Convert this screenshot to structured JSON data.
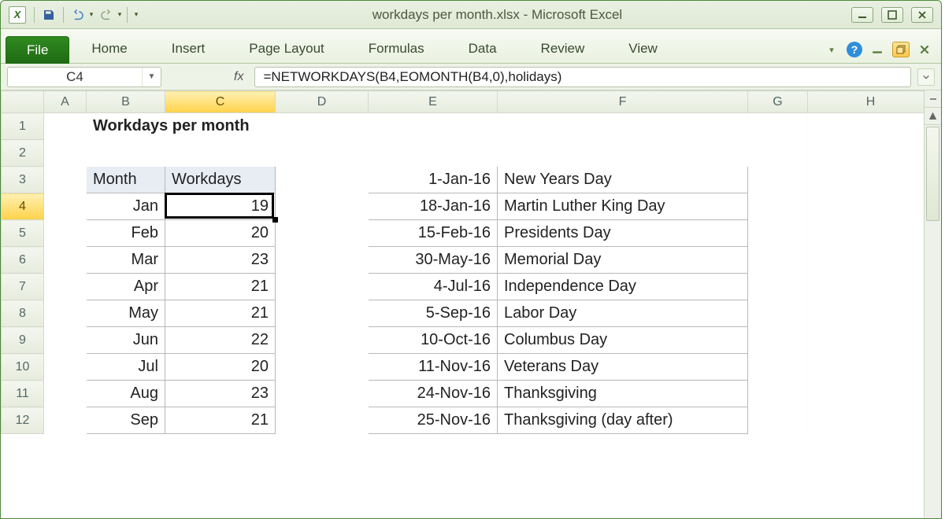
{
  "title": "workdays per month.xlsx  -  Microsoft Excel",
  "ribbon": {
    "file": "File",
    "tabs": [
      "Home",
      "Insert",
      "Page Layout",
      "Formulas",
      "Data",
      "Review",
      "View"
    ]
  },
  "namebox": "C4",
  "fx": "fx",
  "formula": "=NETWORKDAYS(B4,EOMONTH(B4,0),holidays)",
  "columns": [
    "A",
    "B",
    "C",
    "D",
    "E",
    "F",
    "G",
    "H"
  ],
  "rows": [
    "1",
    "2",
    "3",
    "4",
    "5",
    "6",
    "7",
    "8",
    "9",
    "10",
    "11",
    "12"
  ],
  "sheet_title": "Workdays per month",
  "table1": {
    "headers": {
      "b": "Month",
      "c": "Workdays"
    },
    "rows": [
      {
        "b": "Jan",
        "c": "19"
      },
      {
        "b": "Feb",
        "c": "20"
      },
      {
        "b": "Mar",
        "c": "23"
      },
      {
        "b": "Apr",
        "c": "21"
      },
      {
        "b": "May",
        "c": "21"
      },
      {
        "b": "Jun",
        "c": "22"
      },
      {
        "b": "Jul",
        "c": "20"
      },
      {
        "b": "Aug",
        "c": "23"
      },
      {
        "b": "Sep",
        "c": "21"
      }
    ]
  },
  "table2": {
    "rows": [
      {
        "e": "1-Jan-16",
        "f": "New Years Day"
      },
      {
        "e": "18-Jan-16",
        "f": "Martin Luther King Day"
      },
      {
        "e": "15-Feb-16",
        "f": "Presidents Day"
      },
      {
        "e": "30-May-16",
        "f": "Memorial Day"
      },
      {
        "e": "4-Jul-16",
        "f": "Independence Day"
      },
      {
        "e": "5-Sep-16",
        "f": "Labor Day"
      },
      {
        "e": "10-Oct-16",
        "f": "Columbus Day"
      },
      {
        "e": "11-Nov-16",
        "f": "Veterans Day"
      },
      {
        "e": "24-Nov-16",
        "f": "Thanksgiving"
      },
      {
        "e": "25-Nov-16",
        "f": "Thanksgiving (day after)"
      }
    ]
  }
}
